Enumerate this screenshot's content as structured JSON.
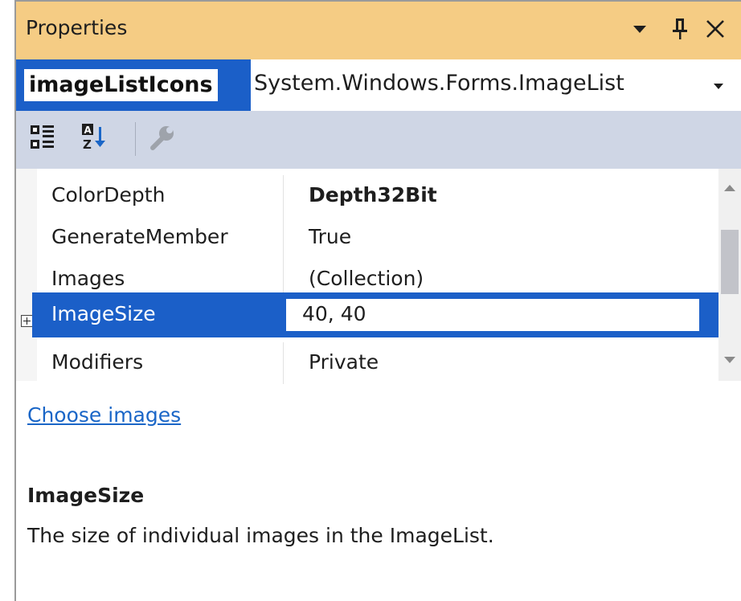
{
  "window": {
    "title": "Properties",
    "icons": [
      "dropdown-icon",
      "pin-icon",
      "close-icon"
    ]
  },
  "object_selector": {
    "name": "imageListIcons",
    "type": "System.Windows.Forms.ImageList"
  },
  "toolbar": {
    "buttons": [
      "categorized-icon",
      "alphabetical-icon",
      "property-pages-icon"
    ]
  },
  "properties": [
    {
      "name": "ColorDepth",
      "value": "Depth32Bit"
    },
    {
      "name": "GenerateMember",
      "value": "True"
    },
    {
      "name": "Images",
      "value": "(Collection)"
    },
    {
      "name": "ImageSize",
      "value": "40, 40"
    },
    {
      "name": "Modifiers",
      "value": "Private"
    }
  ],
  "commands": {
    "link": "Choose images"
  },
  "description": {
    "title": "ImageSize",
    "text": "The size of individual images in the ImageList."
  },
  "colors": {
    "title_bar": "#f5cc84",
    "selection": "#1b5fc8",
    "toolbar": "#cfd6e5",
    "link": "#1a66c7"
  }
}
